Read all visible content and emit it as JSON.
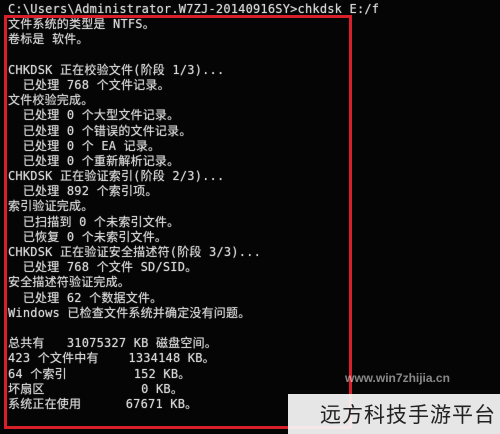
{
  "console": {
    "lines": [
      "C:\\Users\\Administrator.W7ZJ-20140916SY>chkdsk E:/f",
      "文件系统的类型是 NTFS。",
      "卷标是 软件。",
      "",
      "CHKDSK 正在校验文件(阶段 1/3)...",
      "  已处理 768 个文件记录。",
      "文件校验完成。",
      "  已处理 0 个大型文件记录。",
      "  已处理 0 个错误的文件记录。",
      "  已处理 0 个 EA 记录。",
      "  已处理 0 个重新解析记录。",
      "CHKDSK 正在验证索引(阶段 2/3)...",
      "  已处理 892 个索引项。",
      "索引验证完成。",
      "  已扫描到 0 个未索引文件。",
      "  已恢复 0 个未索引文件。",
      "CHKDSK 正在验证安全描述符(阶段 3/3)...",
      "  已处理 768 个文件 SD/SID。",
      "安全描述符验证完成。",
      "  已处理 62 个数据文件。",
      "Windows 已检查文件系统并确定没有问题。",
      "",
      "总共有   31075327 KB 磁盘空间。",
      "423 个文件中有    1334148 KB。",
      "64 个索引         152 KB。",
      "坏扇区             0 KB。",
      "系统正在使用      67671 KB。"
    ]
  },
  "watermark": {
    "url": "www.win7zhijia.cn",
    "brand": "远方科技手游平台"
  },
  "colors": {
    "background": "#050505",
    "text": "#d6d6d6",
    "frame": "#d9202a"
  }
}
